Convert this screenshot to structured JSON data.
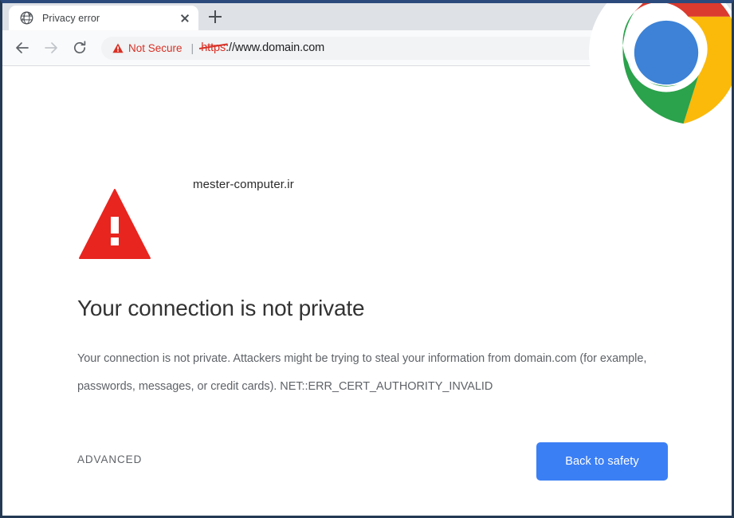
{
  "browser": {
    "tab": {
      "title": "Privacy error",
      "favicon_icon": "globe-icon",
      "close_icon": "close-icon"
    },
    "new_tab_icon": "plus-icon",
    "toolbar": {
      "back_icon": "back-arrow-icon",
      "forward_icon": "forward-arrow-icon",
      "reload_icon": "reload-icon",
      "omnibox": {
        "security_icon": "warning-triangle-icon",
        "security_label": "Not Secure",
        "divider": "|",
        "url_scheme": "https",
        "url_rest": "://www.domain.com"
      }
    }
  },
  "page": {
    "watermark": "mester-computer.ir",
    "warning_icon": "warning-triangle-icon",
    "heading": "Your connection is not private",
    "body": "Your connection is not private. Attackers might be trying to steal your information from domain.com (for example, passwords, messages, or credit cards). NET::ERR_CERT_AUTHORITY_INVALID",
    "advanced_label": "ADVANCED",
    "back_to_safety_label": "Back to safety"
  },
  "overlay": {
    "logo_icon": "chrome-logo-icon"
  },
  "colors": {
    "tabstrip_bg": "#dee1e6",
    "toolbar_bg": "#f9fafb",
    "omnibox_bg": "#f1f3f4",
    "danger_red": "#d93025",
    "warning_triangle_red": "#e8251f",
    "button_blue": "#3b7ff5",
    "window_border": "#243a54",
    "heading_gray": "#333333",
    "body_gray": "#5f6368"
  }
}
